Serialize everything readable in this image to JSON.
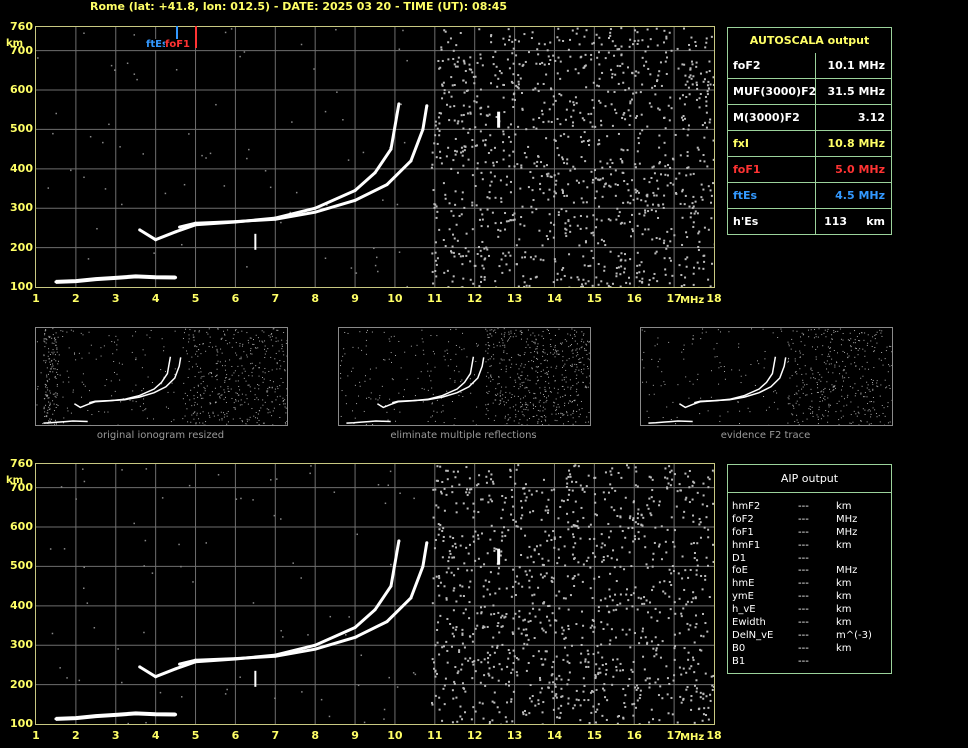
{
  "header": {
    "text": "Rome (lat: +41.8, lon: 012.5) - DATE: 2025 03 20 - TIME (UT): 08:45"
  },
  "axes": {
    "y_ticks": [
      "760",
      "700",
      "600",
      "500",
      "400",
      "300",
      "200",
      "100"
    ],
    "y_unit": "km",
    "x_ticks": [
      "1",
      "2",
      "3",
      "4",
      "5",
      "6",
      "7",
      "8",
      "9",
      "10",
      "11",
      "12",
      "13",
      "14",
      "15",
      "16",
      "17",
      "18"
    ],
    "x_unit": "MHz"
  },
  "markers": {
    "ftEs": "ftEs",
    "foF1": "foF1"
  },
  "autoscala": {
    "title": "AUTOSCALA output",
    "rows": [
      {
        "label": "foF2",
        "value": "10.1 MHz",
        "color": "#ffffff"
      },
      {
        "label": "MUF(3000)F2",
        "value": "31.5 MHz",
        "color": "#ffffff"
      },
      {
        "label": "M(3000)F2",
        "value": "3.12",
        "color": "#ffffff"
      },
      {
        "label": "fxI",
        "value": "10.8 MHz",
        "color": "#ffff66"
      },
      {
        "label": "foF1",
        "value": "5.0 MHz",
        "color": "#ff3333"
      },
      {
        "label": "ftEs",
        "value": "4.5 MHz",
        "color": "#3399ff"
      },
      {
        "label": "h'Es",
        "value": "113     km",
        "color": "#ffffff"
      }
    ]
  },
  "thumbnails": [
    {
      "caption": "original ionogram resized"
    },
    {
      "caption": "eliminate multiple reflections"
    },
    {
      "caption": "evidence F2 trace"
    }
  ],
  "aip": {
    "title": "AIP output",
    "rows": [
      {
        "param": "hmF2",
        "dash": "---",
        "unit": "km"
      },
      {
        "param": "foF2",
        "dash": "---",
        "unit": "MHz"
      },
      {
        "param": "foF1",
        "dash": "---",
        "unit": "MHz"
      },
      {
        "param": "hmF1",
        "dash": "---",
        "unit": "km"
      },
      {
        "param": "D1",
        "dash": "---",
        "unit": ""
      },
      {
        "param": "foE",
        "dash": "---",
        "unit": "MHz"
      },
      {
        "param": "hmE",
        "dash": "---",
        "unit": "km"
      },
      {
        "param": "ymE",
        "dash": "---",
        "unit": "km"
      },
      {
        "param": "h_vE",
        "dash": "---",
        "unit": "km"
      },
      {
        "param": "Ewidth",
        "dash": "---",
        "unit": "km"
      },
      {
        "param": "DelN_vE",
        "dash": "---",
        "unit": "m^(-3)"
      },
      {
        "param": "B0",
        "dash": "---",
        "unit": "km"
      },
      {
        "param": "B1",
        "dash": "---",
        "unit": ""
      }
    ]
  },
  "colors": {
    "axis_text": "#ffff66",
    "frame": "#c8c882",
    "grid": "#6e6e6e",
    "trace": "#ffffff",
    "ftEs": "#3399ff",
    "foF1": "#ff3333"
  },
  "chart_data": {
    "type": "scatter",
    "xlabel": "MHz",
    "ylabel": "km",
    "xlim": [
      1,
      18
    ],
    "ylim": [
      100,
      760
    ],
    "grid": true,
    "series": [
      {
        "name": "ftEs",
        "x": [
          1.5,
          2,
          2.5,
          3,
          3.5,
          4,
          4.5
        ],
        "y": [
          113,
          115,
          120,
          123,
          127,
          125,
          124
        ]
      },
      {
        "name": "foF1",
        "x": [
          3.6,
          4,
          4.5,
          5,
          6,
          7,
          8,
          9,
          9.5,
          9.9,
          10.1
        ],
        "y": [
          245,
          220,
          240,
          258,
          265,
          275,
          300,
          345,
          390,
          450,
          565
        ]
      },
      {
        "name": "fxI",
        "x": [
          4.6,
          5,
          6,
          7,
          8,
          9,
          9.8,
          10.4,
          10.7,
          10.8
        ],
        "y": [
          252,
          262,
          266,
          272,
          290,
          320,
          360,
          420,
          500,
          560
        ]
      }
    ]
  }
}
